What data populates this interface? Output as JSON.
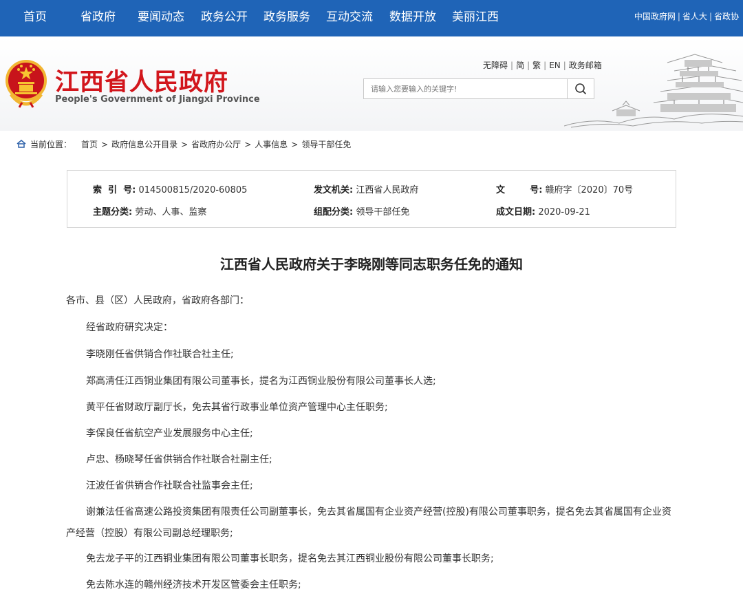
{
  "nav": {
    "items": [
      "首页",
      "省政府",
      "要闻动态",
      "政务公开",
      "政务服务",
      "互动交流",
      "数据开放",
      "美丽江西"
    ],
    "top_links": [
      "中国政府网",
      "省人大",
      "省政协"
    ]
  },
  "header": {
    "title": "江西省人民政府",
    "subtitle": "People's Government of Jiangxi Province",
    "util_links": [
      "无障碍",
      "简",
      "繁",
      "EN",
      "政务邮箱"
    ],
    "search_placeholder": "请输入您要输入的关键字!"
  },
  "breadcrumb": {
    "label": "当前位置：",
    "items": [
      "首页",
      "政府信息公开目录",
      "省政府办公厅",
      "人事信息",
      "领导干部任免"
    ]
  },
  "info": {
    "index_label": "索  引  号:",
    "index_value": "014500815/2020-60805",
    "issuer_label": "发文机关:",
    "issuer_value": "江西省人民政府",
    "docno_label": "文        号:",
    "docno_value": "赣府字〔2020〕70号",
    "topic_label": "主题分类:",
    "topic_value": "劳动、人事、监察",
    "category_label": "组配分类:",
    "category_value": "领导干部任免",
    "date_label": "成文日期:",
    "date_value": "2020-09-21"
  },
  "article": {
    "title": "江西省人民政府关于李晓刚等同志职务任免的通知",
    "salutation": "各市、县（区）人民政府，省政府各部门：",
    "paragraphs": [
      "经省政府研究决定：",
      "李晓刚任省供销合作社联合社主任;",
      "郑高清任江西铜业集团有限公司董事长，提名为江西铜业股份有限公司董事长人选;",
      "黄平任省财政厅副厅长，免去其省行政事业单位资产管理中心主任职务;",
      "李保良任省航空产业发展服务中心主任;",
      "卢忠、杨晓琴任省供销合作社联合社副主任;",
      "汪波任省供销合作社联合社监事会主任;",
      "谢兼法任省高速公路投资集团有限责任公司副董事长，免去其省属国有企业资产经营(控股)有限公司董事职务，提名免去其省属国有企业资产经营（控股）有限公司副总经理职务;",
      "免去龙子平的江西铜业集团有限公司董事长职务，提名免去其江西铜业股份有限公司董事长职务;",
      "免去陈水连的赣州经济技术开发区管委会主任职务;"
    ]
  },
  "colors": {
    "nav_bg": "#1f64b7",
    "title_red": "#d2161c"
  }
}
